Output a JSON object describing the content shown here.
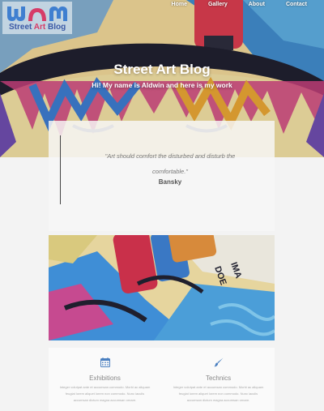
{
  "logo": {
    "mark": "WAM",
    "title_part1": "Street ",
    "title_accent": "Art",
    "title_part2": " Blog"
  },
  "nav": {
    "items": [
      "Home",
      "Gallery",
      "About",
      "Contact"
    ]
  },
  "hero": {
    "title": "Street Art Blog",
    "subtitle": "Hi! My name is Aldwin and here is my work"
  },
  "quote": {
    "text": "\"Art should comfort the disturbed and disturb the comfortable.\"",
    "author": "Bansky"
  },
  "features": [
    {
      "icon": "calendar-icon",
      "title": "Exhibitions",
      "text": "Integer volutpat ante et accumsan commodo. Morbi ac aliquam feugiat lorem aliquet lorem non commodo. Nunc iaculis accumsan dictum magna accumsan ornare."
    },
    {
      "icon": "paintbrush-icon",
      "title": "Technics",
      "text": "Integer volutpat ante et accumsan commodo. Morbi ac aliquam feugiat lorem aliquet lorem non commodo. Nunc iaculis accumsan dictum magna accumsan ornare."
    }
  ]
}
